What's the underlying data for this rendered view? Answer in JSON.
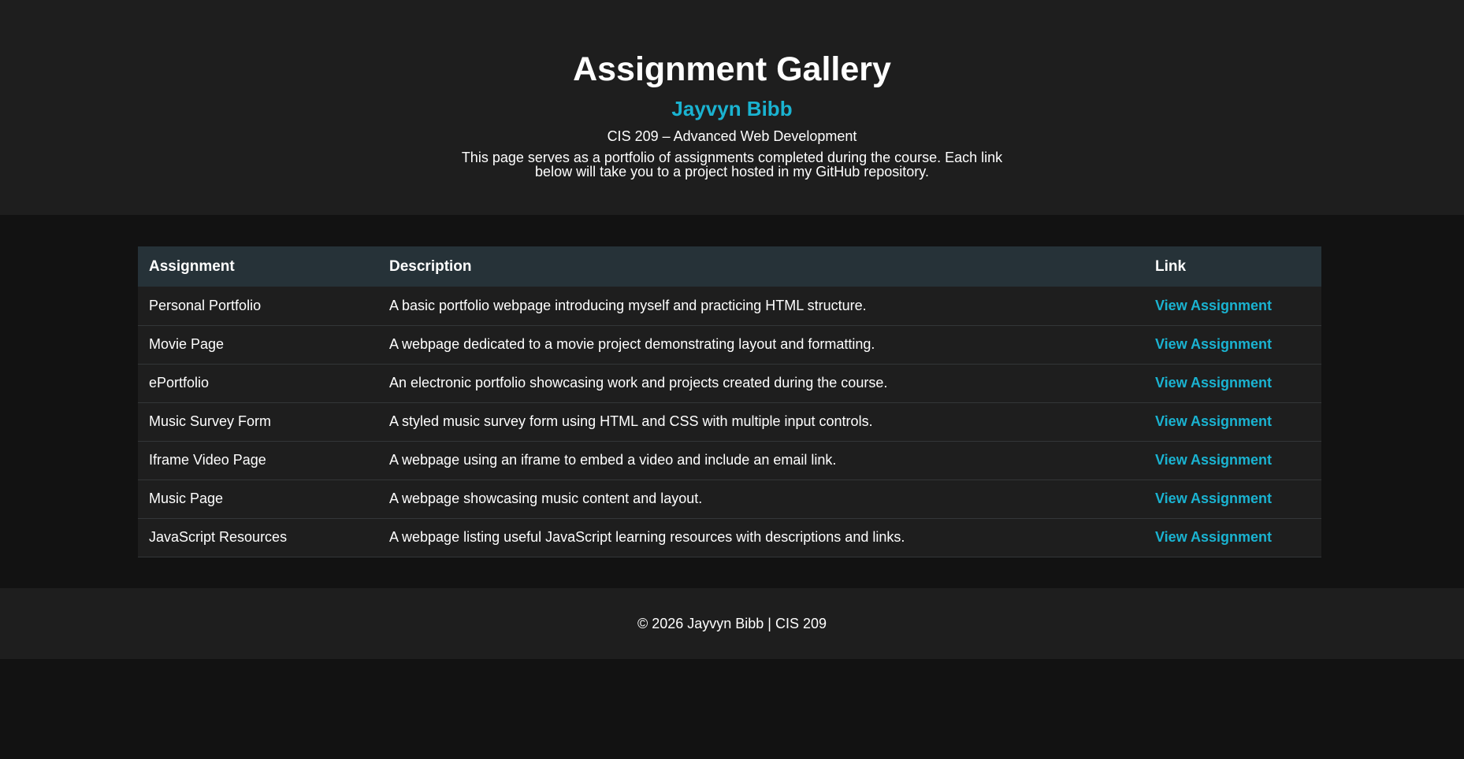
{
  "header": {
    "title": "Assignment Gallery",
    "author": "Jayvyn Bibb",
    "course": "CIS 209 – Advanced Web Development",
    "intro": "This page serves as a portfolio of assignments completed during the course. Each link below will take you to a project hosted in my GitHub repository."
  },
  "table": {
    "columns": [
      "Assignment",
      "Description",
      "Link"
    ],
    "rows": [
      {
        "assignment": "Personal Portfolio",
        "description": "A basic portfolio webpage introducing myself and practicing HTML structure.",
        "link": "View Assignment"
      },
      {
        "assignment": "Movie Page",
        "description": "A webpage dedicated to a movie project demonstrating layout and formatting.",
        "link": "View Assignment"
      },
      {
        "assignment": "ePortfolio",
        "description": "An electronic portfolio showcasing work and projects created during the course.",
        "link": "View Assignment"
      },
      {
        "assignment": "Music Survey Form",
        "description": "A styled music survey form using HTML and CSS with multiple input controls.",
        "link": "View Assignment"
      },
      {
        "assignment": "Iframe Video Page",
        "description": "A webpage using an iframe to embed a video and include an email link.",
        "link": "View Assignment"
      },
      {
        "assignment": "Music Page",
        "description": "A webpage showcasing music content and layout.",
        "link": "View Assignment"
      },
      {
        "assignment": "JavaScript Resources",
        "description": "A webpage listing useful JavaScript learning resources with descriptions and links.",
        "link": "View Assignment"
      }
    ]
  },
  "footer": {
    "text": "© 2026 Jayvyn Bibb | CIS 209"
  },
  "colors": {
    "accent": "#1ab3d1",
    "page_background": "#121212",
    "panel_background": "#1e1e1e",
    "table_header_background": "#263238"
  }
}
